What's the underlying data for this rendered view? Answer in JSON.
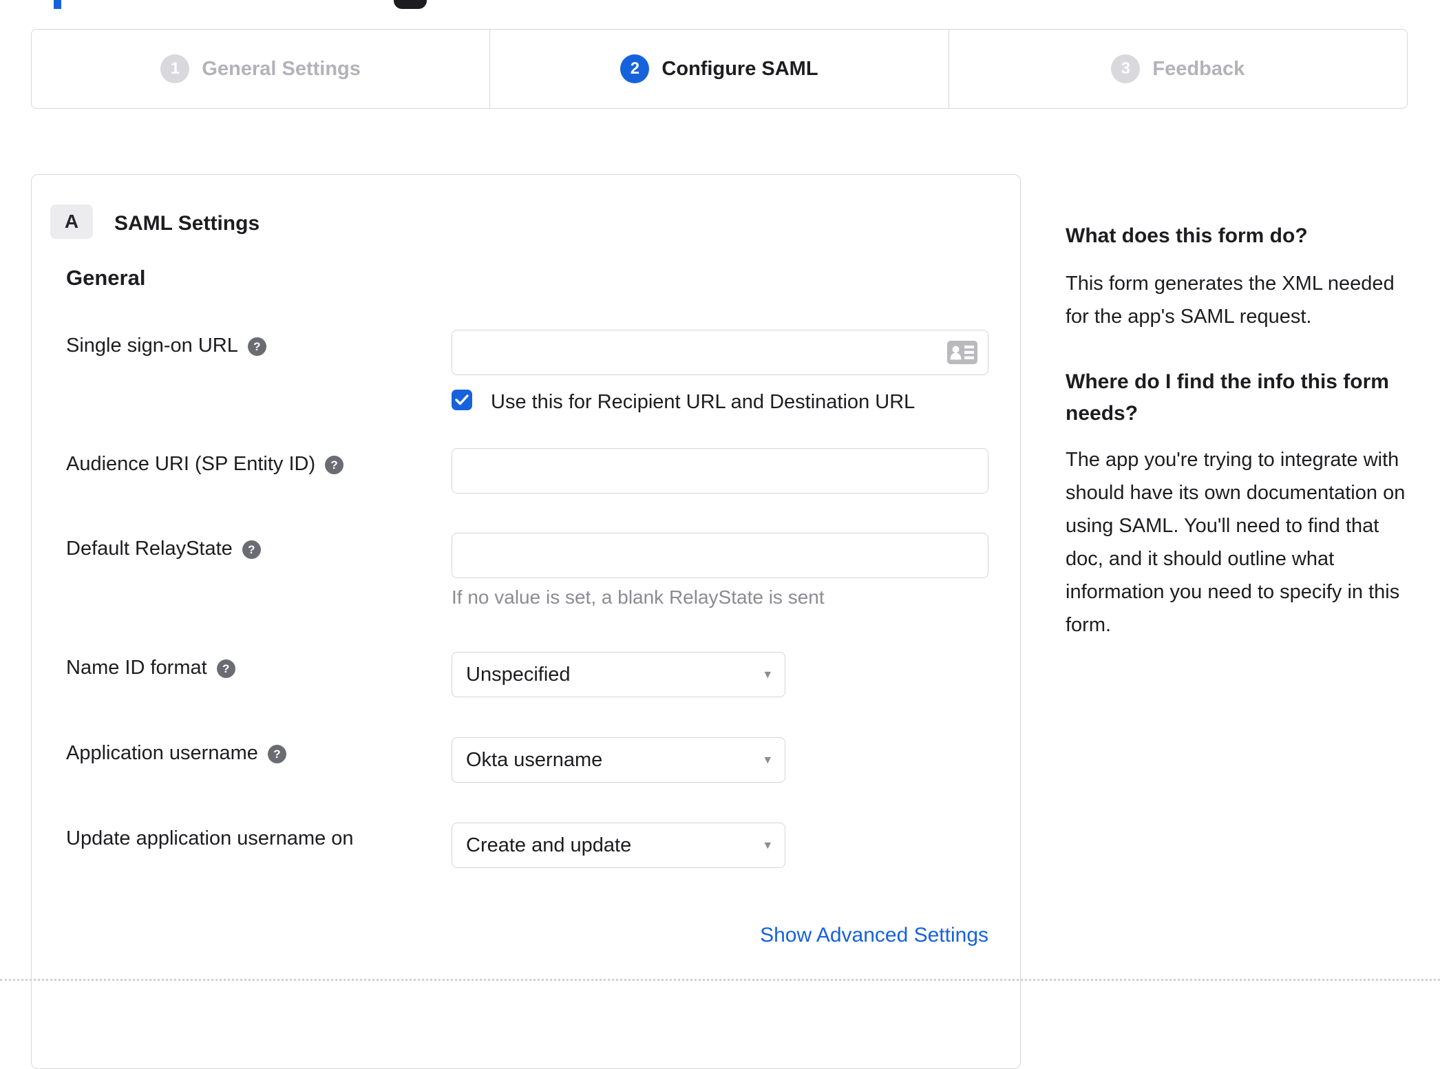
{
  "stepper": {
    "steps": [
      {
        "number": "1",
        "label": "General Settings",
        "state": "inactive"
      },
      {
        "number": "2",
        "label": "Configure SAML",
        "state": "active"
      },
      {
        "number": "3",
        "label": "Feedback",
        "state": "inactive"
      }
    ]
  },
  "panel": {
    "section_badge": "A",
    "section_title": "SAML Settings",
    "group_title": "General",
    "fields": {
      "sso": {
        "label": "Single sign-on URL",
        "value": "",
        "checkbox_label": "Use this for Recipient URL and Destination URL",
        "checked": true
      },
      "audience": {
        "label": "Audience URI (SP Entity ID)",
        "value": ""
      },
      "relay": {
        "label": "Default RelayState",
        "value": "",
        "help_text": "If no value is set, a blank RelayState is sent"
      },
      "nameid": {
        "label": "Name ID format",
        "value": "Unspecified"
      },
      "appuser": {
        "label": "Application username",
        "value": "Okta username"
      },
      "update": {
        "label": "Update application username on",
        "value": "Create and update"
      }
    },
    "advanced_link": "Show Advanced Settings"
  },
  "sidebar": {
    "q1": "What does this form do?",
    "p1_lines": [
      "This form generates the XML needed",
      "for the app's SAML request."
    ],
    "q2_lines": [
      "Where do I find the info this form",
      "needs?"
    ],
    "p2_lines": [
      "The app you're trying to integrate with",
      "should have its own documentation on",
      "using SAML. You'll need to find that",
      "doc, and it should outline what",
      "information you need to specify in this",
      "form."
    ]
  },
  "icons": {
    "help": "?",
    "caret": "▾"
  },
  "colors": {
    "accent_blue": "#1662dd",
    "link_blue": "#1662dd",
    "border_gray": "#d8d8dc",
    "inactive_gray": "#b2b2b8",
    "helper_gray": "#8b8b92"
  }
}
